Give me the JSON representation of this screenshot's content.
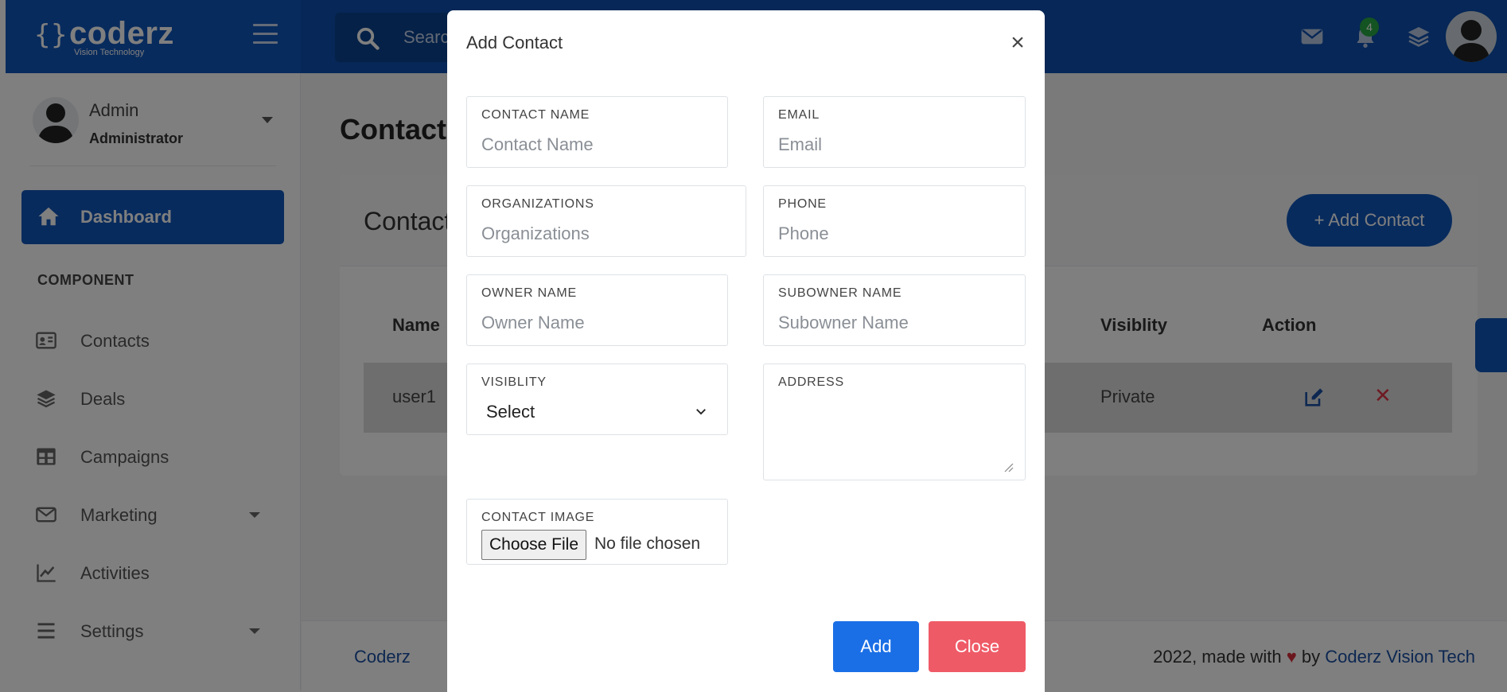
{
  "brand": {
    "name": "coderz",
    "brace": "{}",
    "tagline": "Vision Technology"
  },
  "topbar": {
    "search_placeholder": "Search...",
    "notification_count": "4"
  },
  "sidebar": {
    "user": {
      "name": "Admin",
      "role": "Administrator"
    },
    "dashboard_label": "Dashboard",
    "section_label": "COMPONENT",
    "items": [
      {
        "label": "Contacts",
        "icon": "contact-card-icon",
        "has_caret": false
      },
      {
        "label": "Deals",
        "icon": "layers-icon",
        "has_caret": false
      },
      {
        "label": "Campaigns",
        "icon": "table-icon",
        "has_caret": false
      },
      {
        "label": "Marketing",
        "icon": "envelope-icon",
        "has_caret": true
      },
      {
        "label": "Activities",
        "icon": "line-chart-icon",
        "has_caret": false
      },
      {
        "label": "Settings",
        "icon": "list-icon",
        "has_caret": true
      }
    ]
  },
  "main": {
    "page_title": "Contacts",
    "card_title": "Contacts",
    "add_contact_label": "+ Add Contact",
    "table": {
      "headers": {
        "name": "Name",
        "visibility": "Visiblity",
        "action": "Action"
      },
      "rows": [
        {
          "name": "user1",
          "visibility": "Private"
        }
      ]
    }
  },
  "footer": {
    "left_link": "Coderz",
    "right_text": "2022, made with",
    "heart": "♥",
    "by": "by",
    "right_link": "Coderz Vision Tech"
  },
  "modal": {
    "title": "Add Contact",
    "close_glyph": "×",
    "fields": {
      "contact_name": {
        "label": "CONTACT NAME",
        "placeholder": "Contact Name"
      },
      "email": {
        "label": "EMAIL",
        "placeholder": "Email"
      },
      "organizations": {
        "label": "ORGANIZATIONS",
        "placeholder": "Organizations"
      },
      "phone": {
        "label": "PHONE",
        "placeholder": "Phone"
      },
      "owner_name": {
        "label": "OWNER NAME",
        "placeholder": "Owner Name"
      },
      "subowner_name": {
        "label": "SUBOWNER NAME",
        "placeholder": "Subowner Name"
      },
      "visibility": {
        "label": "VISIBLITY",
        "selected": "Select"
      },
      "address": {
        "label": "ADDRESS"
      },
      "contact_image": {
        "label": "CONTACT IMAGE",
        "button": "Choose File",
        "status": "No file chosen"
      }
    },
    "add_label": "Add",
    "close_label": "Close"
  },
  "colors": {
    "primary": "#1157bb",
    "topbar": "#0d4fae",
    "danger": "#ef5a67",
    "button_blue": "#1a6fe6",
    "badge": "#28a745"
  }
}
